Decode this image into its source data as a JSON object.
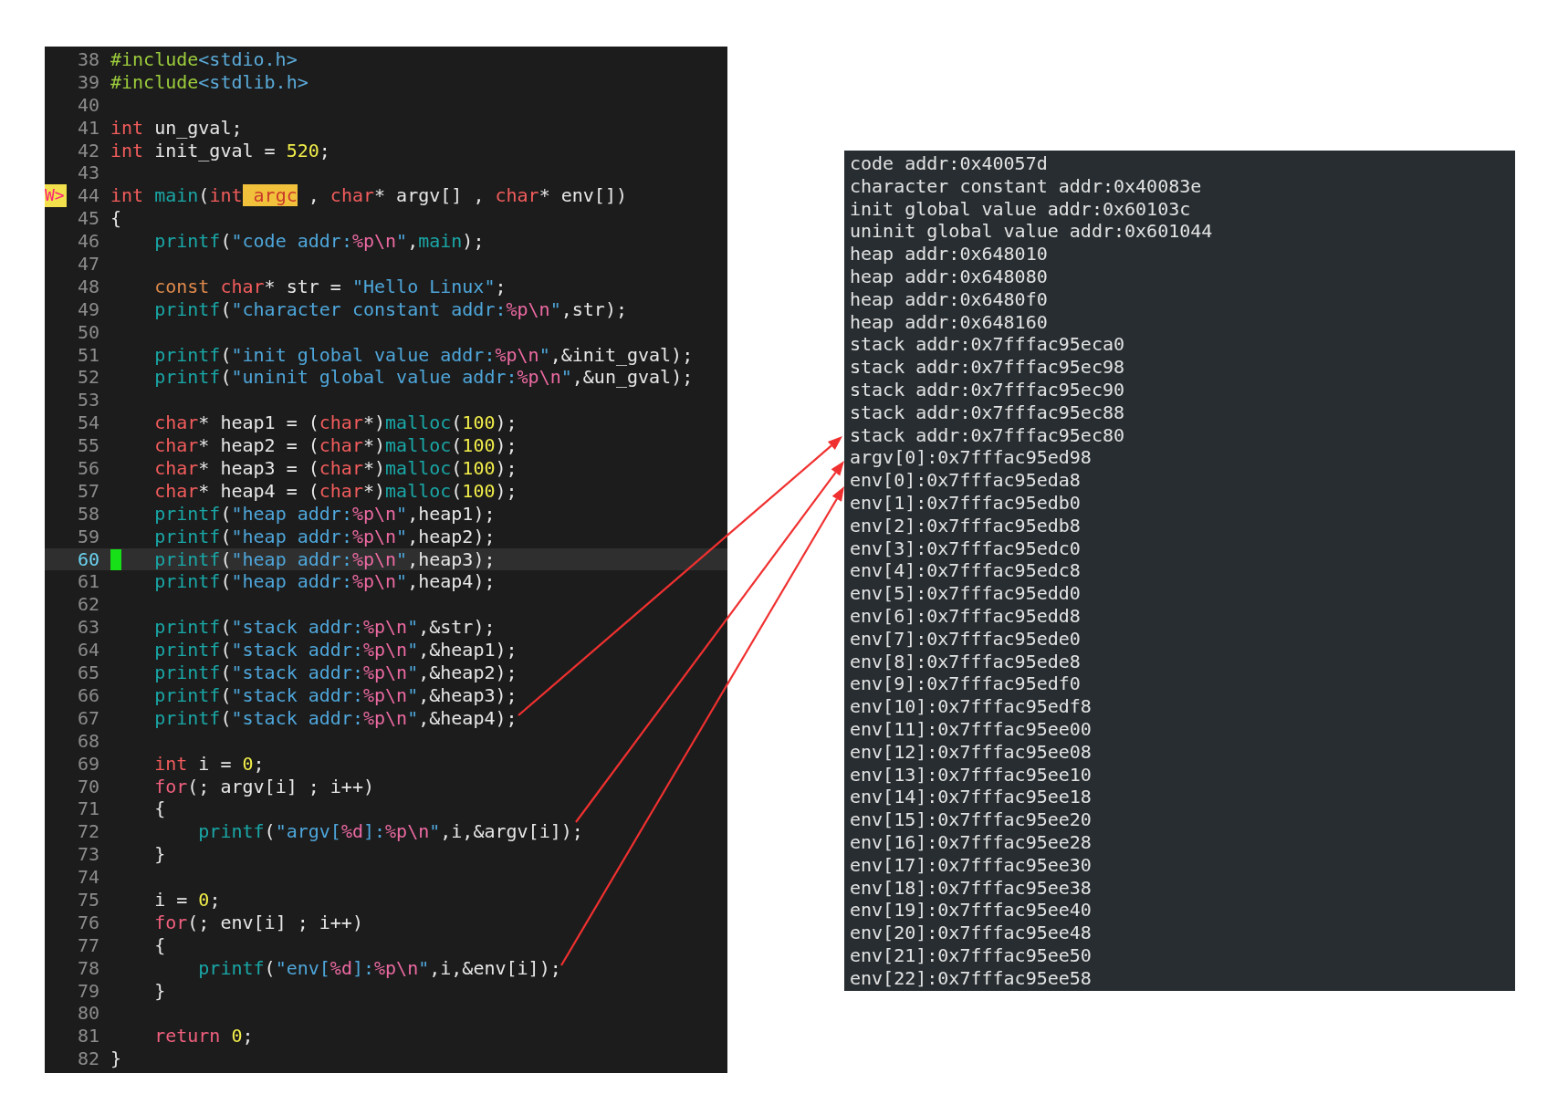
{
  "editor": {
    "lines": [
      {
        "number": "38",
        "current": false,
        "tokens": [
          {
            "kind": "preproc",
            "text": "#include"
          },
          {
            "kind": "header",
            "text": "<stdio.h>"
          }
        ]
      },
      {
        "number": "39",
        "current": false,
        "tokens": [
          {
            "kind": "preproc",
            "text": "#include"
          },
          {
            "kind": "header",
            "text": "<stdlib.h>"
          }
        ]
      },
      {
        "number": "40",
        "current": false
      },
      {
        "number": "41",
        "current": false,
        "tokens": [
          {
            "kind": "type",
            "text": "int"
          },
          {
            "kind": "plain",
            "text": " un_gval;"
          }
        ]
      },
      {
        "number": "42",
        "current": false,
        "tokens": [
          {
            "kind": "type",
            "text": "int"
          },
          {
            "kind": "plain",
            "text": " init_gval = "
          },
          {
            "kind": "number",
            "text": "520"
          },
          {
            "kind": "plain",
            "text": ";"
          }
        ]
      },
      {
        "number": "43",
        "current": false
      },
      {
        "number": "44",
        "current": false,
        "sign": {
          "kind": "warning",
          "text": "W>"
        },
        "tokens": [
          {
            "kind": "type",
            "text": "int"
          },
          {
            "kind": "func",
            "text": " main"
          },
          {
            "kind": "plain",
            "text": "("
          },
          {
            "kind": "type",
            "text": "int"
          },
          {
            "kind": "match",
            "text": " argc"
          },
          {
            "kind": "plain",
            "text": " , "
          },
          {
            "kind": "type",
            "text": "char"
          },
          {
            "kind": "plain",
            "text": "* argv[] , "
          },
          {
            "kind": "type",
            "text": "char"
          },
          {
            "kind": "plain",
            "text": "* env[])"
          }
        ]
      },
      {
        "number": "45",
        "current": false,
        "tokens": [
          {
            "kind": "plain",
            "text": "{"
          }
        ]
      },
      {
        "number": "46",
        "current": false,
        "tokens": [
          {
            "kind": "func",
            "text": "    printf"
          },
          {
            "kind": "plain",
            "text": "("
          },
          {
            "kind": "string",
            "text": "\"code addr:"
          },
          {
            "kind": "escape",
            "text": "%p\\n"
          },
          {
            "kind": "string",
            "text": "\""
          },
          {
            "kind": "plain",
            "text": ","
          },
          {
            "kind": "func",
            "text": "main"
          },
          {
            "kind": "plain",
            "text": ");"
          }
        ]
      },
      {
        "number": "47",
        "current": false
      },
      {
        "number": "48",
        "current": false,
        "tokens": [
          {
            "kind": "storage",
            "text": "    const"
          },
          {
            "kind": "type",
            "text": " char"
          },
          {
            "kind": "plain",
            "text": "* str = "
          },
          {
            "kind": "string",
            "text": "\"Hello Linux\""
          },
          {
            "kind": "plain",
            "text": ";"
          }
        ]
      },
      {
        "number": "49",
        "current": false,
        "tokens": [
          {
            "kind": "func",
            "text": "    printf"
          },
          {
            "kind": "plain",
            "text": "("
          },
          {
            "kind": "string",
            "text": "\"character constant addr:"
          },
          {
            "kind": "escape",
            "text": "%p\\n"
          },
          {
            "kind": "string",
            "text": "\""
          },
          {
            "kind": "plain",
            "text": ",str);"
          }
        ]
      },
      {
        "number": "50",
        "current": false
      },
      {
        "number": "51",
        "current": false,
        "tokens": [
          {
            "kind": "func",
            "text": "    printf"
          },
          {
            "kind": "plain",
            "text": "("
          },
          {
            "kind": "string",
            "text": "\"init global value addr:"
          },
          {
            "kind": "escape",
            "text": "%p\\n"
          },
          {
            "kind": "string",
            "text": "\""
          },
          {
            "kind": "plain",
            "text": ",&init_gval);"
          }
        ]
      },
      {
        "number": "52",
        "current": false,
        "tokens": [
          {
            "kind": "func",
            "text": "    printf"
          },
          {
            "kind": "plain",
            "text": "("
          },
          {
            "kind": "string",
            "text": "\"uninit global value addr:"
          },
          {
            "kind": "escape",
            "text": "%p\\n"
          },
          {
            "kind": "string",
            "text": "\""
          },
          {
            "kind": "plain",
            "text": ",&un_gval);"
          }
        ]
      },
      {
        "number": "53",
        "current": false
      },
      {
        "number": "54",
        "current": false,
        "tokens": [
          {
            "kind": "type",
            "text": "    char"
          },
          {
            "kind": "plain",
            "text": "* heap1 = ("
          },
          {
            "kind": "type",
            "text": "char"
          },
          {
            "kind": "plain",
            "text": "*)"
          },
          {
            "kind": "func",
            "text": "malloc"
          },
          {
            "kind": "plain",
            "text": "("
          },
          {
            "kind": "number",
            "text": "100"
          },
          {
            "kind": "plain",
            "text": ");"
          }
        ]
      },
      {
        "number": "55",
        "current": false,
        "tokens": [
          {
            "kind": "type",
            "text": "    char"
          },
          {
            "kind": "plain",
            "text": "* heap2 = ("
          },
          {
            "kind": "type",
            "text": "char"
          },
          {
            "kind": "plain",
            "text": "*)"
          },
          {
            "kind": "func",
            "text": "malloc"
          },
          {
            "kind": "plain",
            "text": "("
          },
          {
            "kind": "number",
            "text": "100"
          },
          {
            "kind": "plain",
            "text": ");"
          }
        ]
      },
      {
        "number": "56",
        "current": false,
        "tokens": [
          {
            "kind": "type",
            "text": "    char"
          },
          {
            "kind": "plain",
            "text": "* heap3 = ("
          },
          {
            "kind": "type",
            "text": "char"
          },
          {
            "kind": "plain",
            "text": "*)"
          },
          {
            "kind": "func",
            "text": "malloc"
          },
          {
            "kind": "plain",
            "text": "("
          },
          {
            "kind": "number",
            "text": "100"
          },
          {
            "kind": "plain",
            "text": ");"
          }
        ]
      },
      {
        "number": "57",
        "current": false,
        "tokens": [
          {
            "kind": "type",
            "text": "    char"
          },
          {
            "kind": "plain",
            "text": "* heap4 = ("
          },
          {
            "kind": "type",
            "text": "char"
          },
          {
            "kind": "plain",
            "text": "*)"
          },
          {
            "kind": "func",
            "text": "malloc"
          },
          {
            "kind": "plain",
            "text": "("
          },
          {
            "kind": "number",
            "text": "100"
          },
          {
            "kind": "plain",
            "text": ");"
          }
        ]
      },
      {
        "number": "58",
        "current": false,
        "tokens": [
          {
            "kind": "func",
            "text": "    printf"
          },
          {
            "kind": "plain",
            "text": "("
          },
          {
            "kind": "string",
            "text": "\"heap addr:"
          },
          {
            "kind": "escape",
            "text": "%p\\n"
          },
          {
            "kind": "string",
            "text": "\""
          },
          {
            "kind": "plain",
            "text": ",heap1);"
          }
        ]
      },
      {
        "number": "59",
        "current": false,
        "tokens": [
          {
            "kind": "func",
            "text": "    printf"
          },
          {
            "kind": "plain",
            "text": "("
          },
          {
            "kind": "string",
            "text": "\"heap addr:"
          },
          {
            "kind": "escape",
            "text": "%p\\n"
          },
          {
            "kind": "string",
            "text": "\""
          },
          {
            "kind": "plain",
            "text": ",heap2);"
          }
        ]
      },
      {
        "number": "60",
        "current": true,
        "sign": {
          "kind": "marker"
        },
        "tokens": [
          {
            "kind": "func",
            "text": "    printf"
          },
          {
            "kind": "plain",
            "text": "("
          },
          {
            "kind": "string",
            "text": "\"heap addr:"
          },
          {
            "kind": "escape",
            "text": "%p\\n"
          },
          {
            "kind": "string",
            "text": "\""
          },
          {
            "kind": "plain",
            "text": ",heap3);"
          }
        ]
      },
      {
        "number": "61",
        "current": false,
        "tokens": [
          {
            "kind": "func",
            "text": "    printf"
          },
          {
            "kind": "plain",
            "text": "("
          },
          {
            "kind": "string",
            "text": "\"heap addr:"
          },
          {
            "kind": "escape",
            "text": "%p\\n"
          },
          {
            "kind": "string",
            "text": "\""
          },
          {
            "kind": "plain",
            "text": ",heap4);"
          }
        ]
      },
      {
        "number": "62",
        "current": false
      },
      {
        "number": "63",
        "current": false,
        "tokens": [
          {
            "kind": "func",
            "text": "    printf"
          },
          {
            "kind": "plain",
            "text": "("
          },
          {
            "kind": "string",
            "text": "\"stack addr:"
          },
          {
            "kind": "escape",
            "text": "%p\\n"
          },
          {
            "kind": "string",
            "text": "\""
          },
          {
            "kind": "plain",
            "text": ",&str);"
          }
        ]
      },
      {
        "number": "64",
        "current": false,
        "tokens": [
          {
            "kind": "func",
            "text": "    printf"
          },
          {
            "kind": "plain",
            "text": "("
          },
          {
            "kind": "string",
            "text": "\"stack addr:"
          },
          {
            "kind": "escape",
            "text": "%p\\n"
          },
          {
            "kind": "string",
            "text": "\""
          },
          {
            "kind": "plain",
            "text": ",&heap1);"
          }
        ]
      },
      {
        "number": "65",
        "current": false,
        "tokens": [
          {
            "kind": "func",
            "text": "    printf"
          },
          {
            "kind": "plain",
            "text": "("
          },
          {
            "kind": "string",
            "text": "\"stack addr:"
          },
          {
            "kind": "escape",
            "text": "%p\\n"
          },
          {
            "kind": "string",
            "text": "\""
          },
          {
            "kind": "plain",
            "text": ",&heap2);"
          }
        ]
      },
      {
        "number": "66",
        "current": false,
        "tokens": [
          {
            "kind": "func",
            "text": "    printf"
          },
          {
            "kind": "plain",
            "text": "("
          },
          {
            "kind": "string",
            "text": "\"stack addr:"
          },
          {
            "kind": "escape",
            "text": "%p\\n"
          },
          {
            "kind": "string",
            "text": "\""
          },
          {
            "kind": "plain",
            "text": ",&heap3);"
          }
        ]
      },
      {
        "number": "67",
        "current": false,
        "tokens": [
          {
            "kind": "func",
            "text": "    printf"
          },
          {
            "kind": "plain",
            "text": "("
          },
          {
            "kind": "string",
            "text": "\"stack addr:"
          },
          {
            "kind": "escape",
            "text": "%p\\n"
          },
          {
            "kind": "string",
            "text": "\""
          },
          {
            "kind": "plain",
            "text": ",&heap4);"
          }
        ]
      },
      {
        "number": "68",
        "current": false
      },
      {
        "number": "69",
        "current": false,
        "tokens": [
          {
            "kind": "type",
            "text": "    int"
          },
          {
            "kind": "plain",
            "text": " i = "
          },
          {
            "kind": "number",
            "text": "0"
          },
          {
            "kind": "plain",
            "text": ";"
          }
        ]
      },
      {
        "number": "70",
        "current": false,
        "tokens": [
          {
            "kind": "keyword",
            "text": "    for"
          },
          {
            "kind": "plain",
            "text": "(; argv[i] ; i++)"
          }
        ]
      },
      {
        "number": "71",
        "current": false,
        "tokens": [
          {
            "kind": "plain",
            "text": "    {"
          }
        ]
      },
      {
        "number": "72",
        "current": false,
        "tokens": [
          {
            "kind": "func",
            "text": "        printf"
          },
          {
            "kind": "plain",
            "text": "("
          },
          {
            "kind": "string",
            "text": "\"argv["
          },
          {
            "kind": "escape",
            "text": "%d"
          },
          {
            "kind": "string",
            "text": "]:"
          },
          {
            "kind": "escape",
            "text": "%p\\n"
          },
          {
            "kind": "string",
            "text": "\""
          },
          {
            "kind": "plain",
            "text": ",i,&argv[i]);"
          }
        ]
      },
      {
        "number": "73",
        "current": false,
        "tokens": [
          {
            "kind": "plain",
            "text": "    }"
          }
        ]
      },
      {
        "number": "74",
        "current": false
      },
      {
        "number": "75",
        "current": false,
        "tokens": [
          {
            "kind": "plain",
            "text": "    i = "
          },
          {
            "kind": "number",
            "text": "0"
          },
          {
            "kind": "plain",
            "text": ";"
          }
        ]
      },
      {
        "number": "76",
        "current": false,
        "tokens": [
          {
            "kind": "keyword",
            "text": "    for"
          },
          {
            "kind": "plain",
            "text": "(; env[i] ; i++)"
          }
        ]
      },
      {
        "number": "77",
        "current": false,
        "tokens": [
          {
            "kind": "plain",
            "text": "    {"
          }
        ]
      },
      {
        "number": "78",
        "current": false,
        "tokens": [
          {
            "kind": "func",
            "text": "        printf"
          },
          {
            "kind": "plain",
            "text": "("
          },
          {
            "kind": "string",
            "text": "\"env["
          },
          {
            "kind": "escape",
            "text": "%d"
          },
          {
            "kind": "string",
            "text": "]:"
          },
          {
            "kind": "escape",
            "text": "%p\\n"
          },
          {
            "kind": "string",
            "text": "\""
          },
          {
            "kind": "plain",
            "text": ",i,&env[i]);"
          }
        ]
      },
      {
        "number": "79",
        "current": false,
        "tokens": [
          {
            "kind": "plain",
            "text": "    }"
          }
        ]
      },
      {
        "number": "80",
        "current": false
      },
      {
        "number": "81",
        "current": false,
        "tokens": [
          {
            "kind": "keyword",
            "text": "    return"
          },
          {
            "kind": "number",
            "text": " 0"
          },
          {
            "kind": "plain",
            "text": ";"
          }
        ]
      },
      {
        "number": "82",
        "current": false,
        "tokens": [
          {
            "kind": "plain",
            "text": "}"
          }
        ]
      }
    ]
  },
  "terminal": {
    "lines": [
      "code addr:0x40057d",
      "character constant addr:0x40083e",
      "init global value addr:0x60103c",
      "uninit global value addr:0x601044",
      "heap addr:0x648010",
      "heap addr:0x648080",
      "heap addr:0x6480f0",
      "heap addr:0x648160",
      "stack addr:0x7fffac95eca0",
      "stack addr:0x7fffac95ec98",
      "stack addr:0x7fffac95ec90",
      "stack addr:0x7fffac95ec88",
      "stack addr:0x7fffac95ec80",
      "argv[0]:0x7fffac95ed98",
      "env[0]:0x7fffac95eda8",
      "env[1]:0x7fffac95edb0",
      "env[2]:0x7fffac95edb8",
      "env[3]:0x7fffac95edc0",
      "env[4]:0x7fffac95edc8",
      "env[5]:0x7fffac95edd0",
      "env[6]:0x7fffac95edd8",
      "env[7]:0x7fffac95ede0",
      "env[8]:0x7fffac95ede8",
      "env[9]:0x7fffac95edf0",
      "env[10]:0x7fffac95edf8",
      "env[11]:0x7fffac95ee00",
      "env[12]:0x7fffac95ee08",
      "env[13]:0x7fffac95ee10",
      "env[14]:0x7fffac95ee18",
      "env[15]:0x7fffac95ee20",
      "env[16]:0x7fffac95ee28",
      "env[17]:0x7fffac95ee30",
      "env[18]:0x7fffac95ee38",
      "env[19]:0x7fffac95ee40",
      "env[20]:0x7fffac95ee48",
      "env[21]:0x7fffac95ee50",
      "env[22]:0x7fffac95ee58"
    ]
  }
}
